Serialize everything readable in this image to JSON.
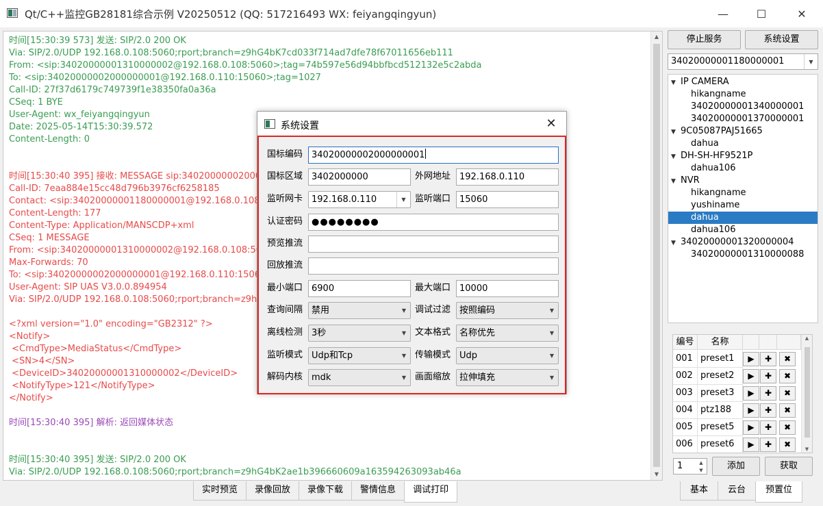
{
  "window": {
    "title": "Qt/C++监控GB28181综合示例 V20250512 (QQ: 517216493 WX: feiyangqingyun)",
    "minimize": "—",
    "maximize": "☐",
    "close": "✕"
  },
  "log": {
    "lines": [
      {
        "text": "时间[15:30:39 573] 发送: SIP/2.0 200 OK",
        "color": "green"
      },
      {
        "text": "Via: SIP/2.0/UDP 192.168.0.108:5060;rport;branch=z9hG4bK7cd033f714ad7dfe78f67011656eb111",
        "color": "green"
      },
      {
        "text": "From: <sip:34020000001310000002@192.168.0.108:5060>;tag=74b597e56d94bbfbcd512132e5c2abda",
        "color": "green"
      },
      {
        "text": "To: <sip:34020000002000000001@192.168.0.110:15060>;tag=1027",
        "color": "green"
      },
      {
        "text": "Call-ID: 27f37d6179c749739f1e38350fa0a36a",
        "color": "green"
      },
      {
        "text": "CSeq: 1 BYE",
        "color": "green"
      },
      {
        "text": "User-Agent: wx_feiyangqingyun",
        "color": "green"
      },
      {
        "text": "Date: 2025-05-14T15:30:39.572",
        "color": "green"
      },
      {
        "text": "Content-Length: 0",
        "color": "green"
      },
      {
        "text": "",
        "color": "blank"
      },
      {
        "text": "",
        "color": "blank"
      },
      {
        "text": "时间[15:30:40 395] 接收: MESSAGE sip:34020000002000000",
        "color": "red"
      },
      {
        "text": "Call-ID: 7eaa884e15cc48d796b3976cf6258185",
        "color": "red"
      },
      {
        "text": "Contact: <sip:34020000001180000001@192.168.0.108:506",
        "color": "red"
      },
      {
        "text": "Content-Length: 177",
        "color": "red"
      },
      {
        "text": "Content-Type: Application/MANSCDP+xml",
        "color": "red"
      },
      {
        "text": "CSeq: 1 MESSAGE",
        "color": "red"
      },
      {
        "text": "From: <sip:34020000001310000002@192.168.0.108:5060>;",
        "color": "red"
      },
      {
        "text": "Max-Forwards: 70",
        "color": "red"
      },
      {
        "text": "To: <sip:34020000002000000001@192.168.0.110:15060>;",
        "color": "red"
      },
      {
        "text": "User-Agent: SIP UAS V3.0.0.894954",
        "color": "red"
      },
      {
        "text": "Via: SIP/2.0/UDP 192.168.0.108:5060;rport;branch=z9hG4",
        "color": "red"
      },
      {
        "text": "",
        "color": "blank"
      },
      {
        "text": "<?xml version=\"1.0\" encoding=\"GB2312\" ?>",
        "color": "red"
      },
      {
        "text": "<Notify>",
        "color": "red"
      },
      {
        "text": " <CmdType>MediaStatus</CmdType>",
        "color": "red"
      },
      {
        "text": " <SN>4</SN>",
        "color": "red"
      },
      {
        "text": " <DeviceID>34020000001310000002</DeviceID>",
        "color": "red"
      },
      {
        "text": " <NotifyType>121</NotifyType>",
        "color": "red"
      },
      {
        "text": "</Notify>",
        "color": "red"
      },
      {
        "text": "",
        "color": "blank"
      },
      {
        "text": "时间[15:30:40 395] 解析: 返回媒体状态",
        "color": "purple"
      },
      {
        "text": "",
        "color": "blank"
      },
      {
        "text": "",
        "color": "blank"
      },
      {
        "text": "时间[15:30:40 395] 发送: SIP/2.0 200 OK",
        "color": "green"
      },
      {
        "text": "Via: SIP/2.0/UDP 192.168.0.108:5060;rport;branch=z9hG4bK2ae1b396660609a163594263093ab46a",
        "color": "green"
      }
    ]
  },
  "bottom_tabs": [
    "实时预览",
    "录像回放",
    "录像下载",
    "警情信息",
    "调试打印"
  ],
  "bottom_tab_active": 4,
  "right": {
    "stop_label": "停止服务",
    "settings_label": "系统设置",
    "device_select": "34020000001180000001",
    "tree": [
      {
        "label": "IP CAMERA",
        "level": 0,
        "expanded": true
      },
      {
        "label": "hikangname",
        "level": 1
      },
      {
        "label": "34020000001340000001",
        "level": 1
      },
      {
        "label": "34020000001370000001",
        "level": 1
      },
      {
        "label": "9C05087PAJ51665",
        "level": 0,
        "expanded": true
      },
      {
        "label": "dahua",
        "level": 1
      },
      {
        "label": "DH-SH-HF9521P",
        "level": 0,
        "expanded": true
      },
      {
        "label": "dahua106",
        "level": 1
      },
      {
        "label": "NVR",
        "level": 0,
        "expanded": true
      },
      {
        "label": "hikangname",
        "level": 1
      },
      {
        "label": "yushiname",
        "level": 1
      },
      {
        "label": "dahua",
        "level": 1,
        "selected": true
      },
      {
        "label": "dahua106",
        "level": 1
      },
      {
        "label": "34020000001320000004",
        "level": 0,
        "expanded": true
      },
      {
        "label": "34020000001310000088",
        "level": 1
      }
    ],
    "preset_headers": [
      "编号",
      "名称"
    ],
    "presets": [
      {
        "id": "001",
        "name": "preset1"
      },
      {
        "id": "002",
        "name": "preset2"
      },
      {
        "id": "003",
        "name": "preset3"
      },
      {
        "id": "004",
        "name": "ptz188"
      },
      {
        "id": "005",
        "name": "preset5"
      },
      {
        "id": "006",
        "name": "preset6"
      }
    ],
    "preset_btn_play": "▶",
    "preset_btn_add": "✚",
    "preset_btn_del": "✖",
    "spin_value": "1",
    "add_label": "添加",
    "fetch_label": "获取",
    "tabs": [
      "基本",
      "云台",
      "预置位"
    ],
    "tab_active": 2
  },
  "dialog": {
    "title": "系统设置",
    "close": "✕",
    "fields": {
      "gb_code_label": "国标编码",
      "gb_code": "34020000002000000001",
      "gb_region_label": "国标区域",
      "gb_region": "3402000000",
      "wan_label": "外网地址",
      "wan": "192.168.0.110",
      "nic_label": "监听网卡",
      "nic": "192.168.0.110",
      "port_label": "监听端口",
      "port": "15060",
      "pwd_label": "认证密码",
      "pwd": "●●●●●●●●",
      "preview_label": "预览推流",
      "preview": "",
      "playback_label": "回放推流",
      "playback": "",
      "min_port_label": "最小端口",
      "min_port": "6900",
      "max_port_label": "最大端口",
      "max_port": "10000",
      "query_label": "查询间隔",
      "query": "禁用",
      "filter_label": "调试过滤",
      "filter": "按照编码",
      "offline_label": "离线检测",
      "offline": "3秒",
      "textfmt_label": "文本格式",
      "textfmt": "名称优先",
      "listen_mode_label": "监听模式",
      "listen_mode": "Udp和Tcp",
      "trans_mode_label": "传输模式",
      "trans_mode": "Udp",
      "decoder_label": "解码内核",
      "decoder": "mdk",
      "scale_label": "画面缩放",
      "scale": "拉伸填充"
    }
  },
  "colors": {
    "log_green": "#3a9d52",
    "log_red": "#e84a4a",
    "log_purple": "#9a49b8",
    "selection": "#2a7bc4",
    "dialog_highlight": "#e02424"
  }
}
